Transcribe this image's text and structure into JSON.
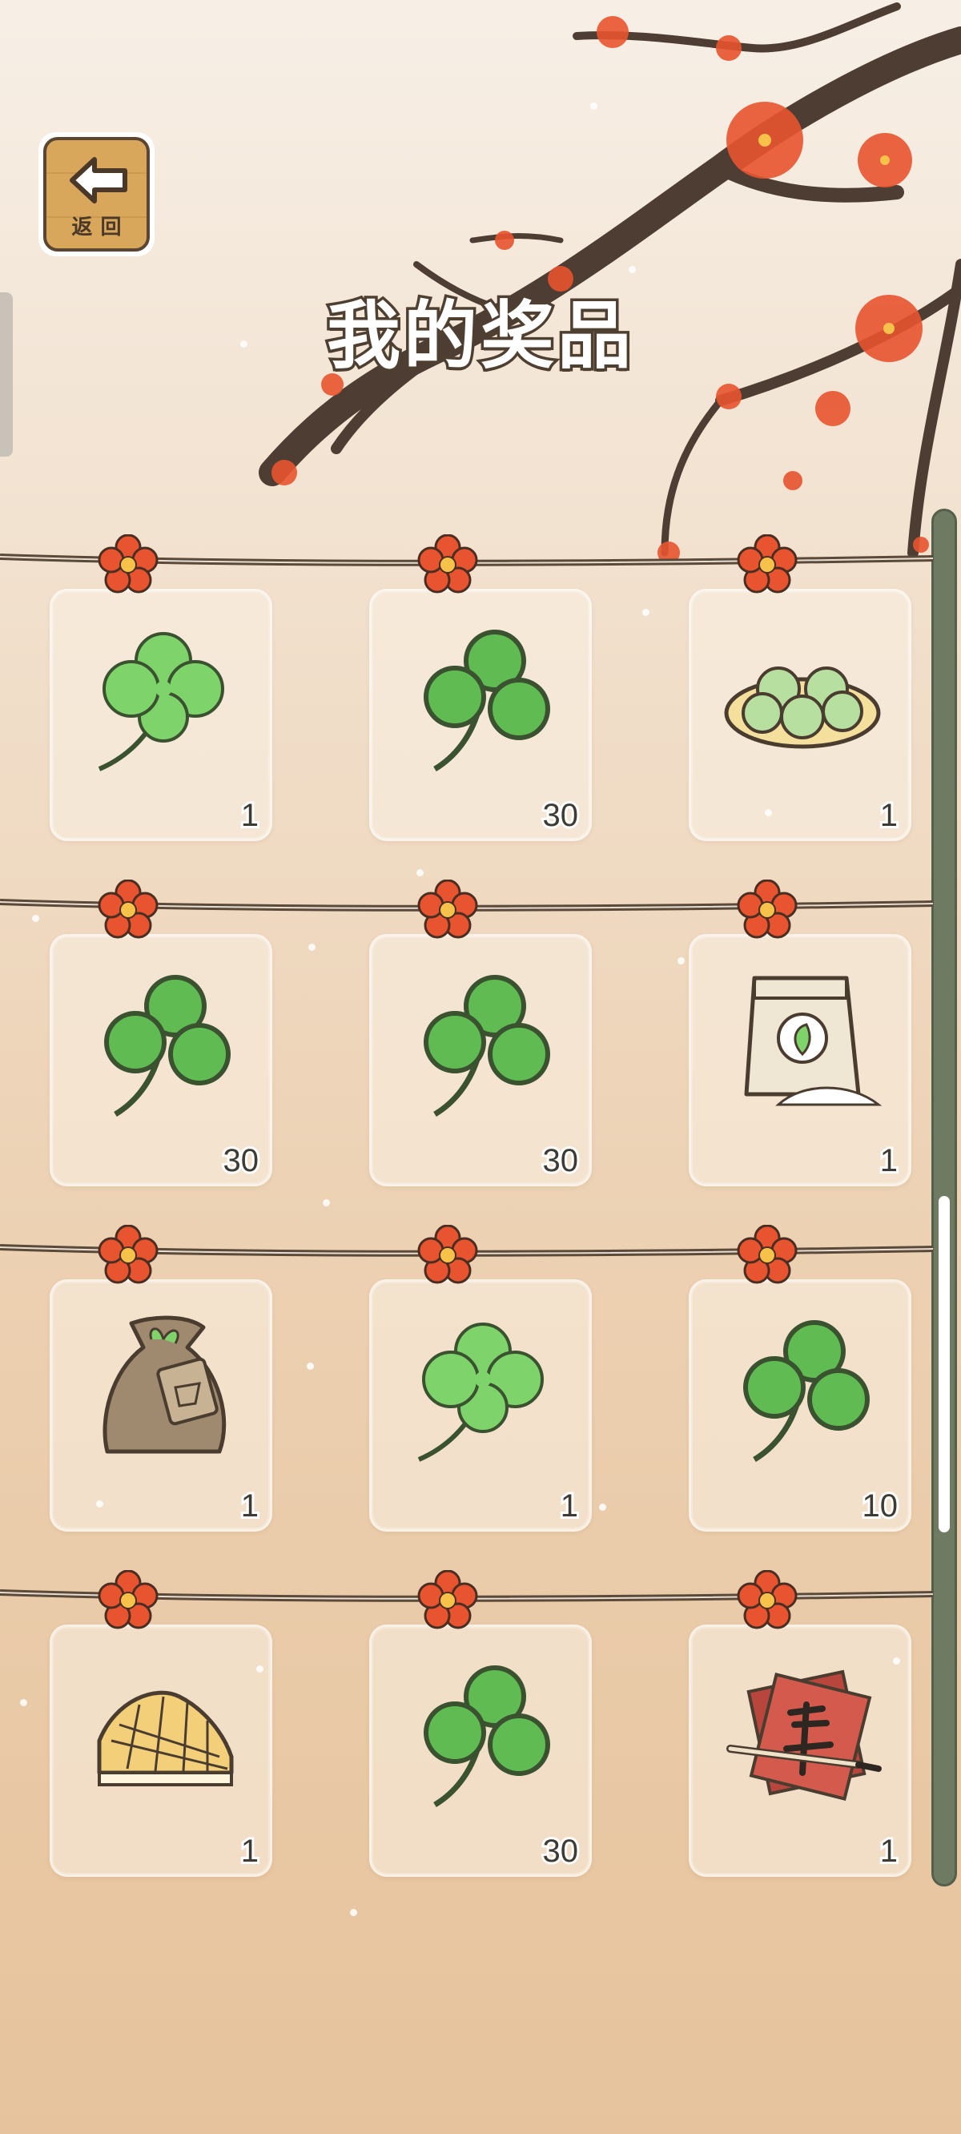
{
  "header": {
    "back_label": "返回",
    "title": "我的奖品"
  },
  "prizes": [
    {
      "icon": "four-leaf-clover-icon",
      "count": "1"
    },
    {
      "icon": "three-leaf-clover-icon",
      "count": "30"
    },
    {
      "icon": "mochi-plate-icon",
      "count": "1"
    },
    {
      "icon": "three-leaf-clover-icon",
      "count": "30"
    },
    {
      "icon": "three-leaf-clover-icon",
      "count": "30"
    },
    {
      "icon": "flour-bag-icon",
      "count": "1"
    },
    {
      "icon": "seed-sack-icon",
      "count": "1"
    },
    {
      "icon": "four-leaf-clover-icon",
      "count": "1"
    },
    {
      "icon": "three-leaf-clover-icon",
      "count": "10"
    },
    {
      "icon": "waffle-icon",
      "count": "1"
    },
    {
      "icon": "three-leaf-clover-icon",
      "count": "30"
    },
    {
      "icon": "calligraphy-paper-icon",
      "count": "1"
    }
  ],
  "colors": {
    "clover_green": "#5fbb52",
    "clover_outline": "#3a5230",
    "blossom_red": "#e8542f",
    "rope_brown": "#5b4a3a"
  }
}
